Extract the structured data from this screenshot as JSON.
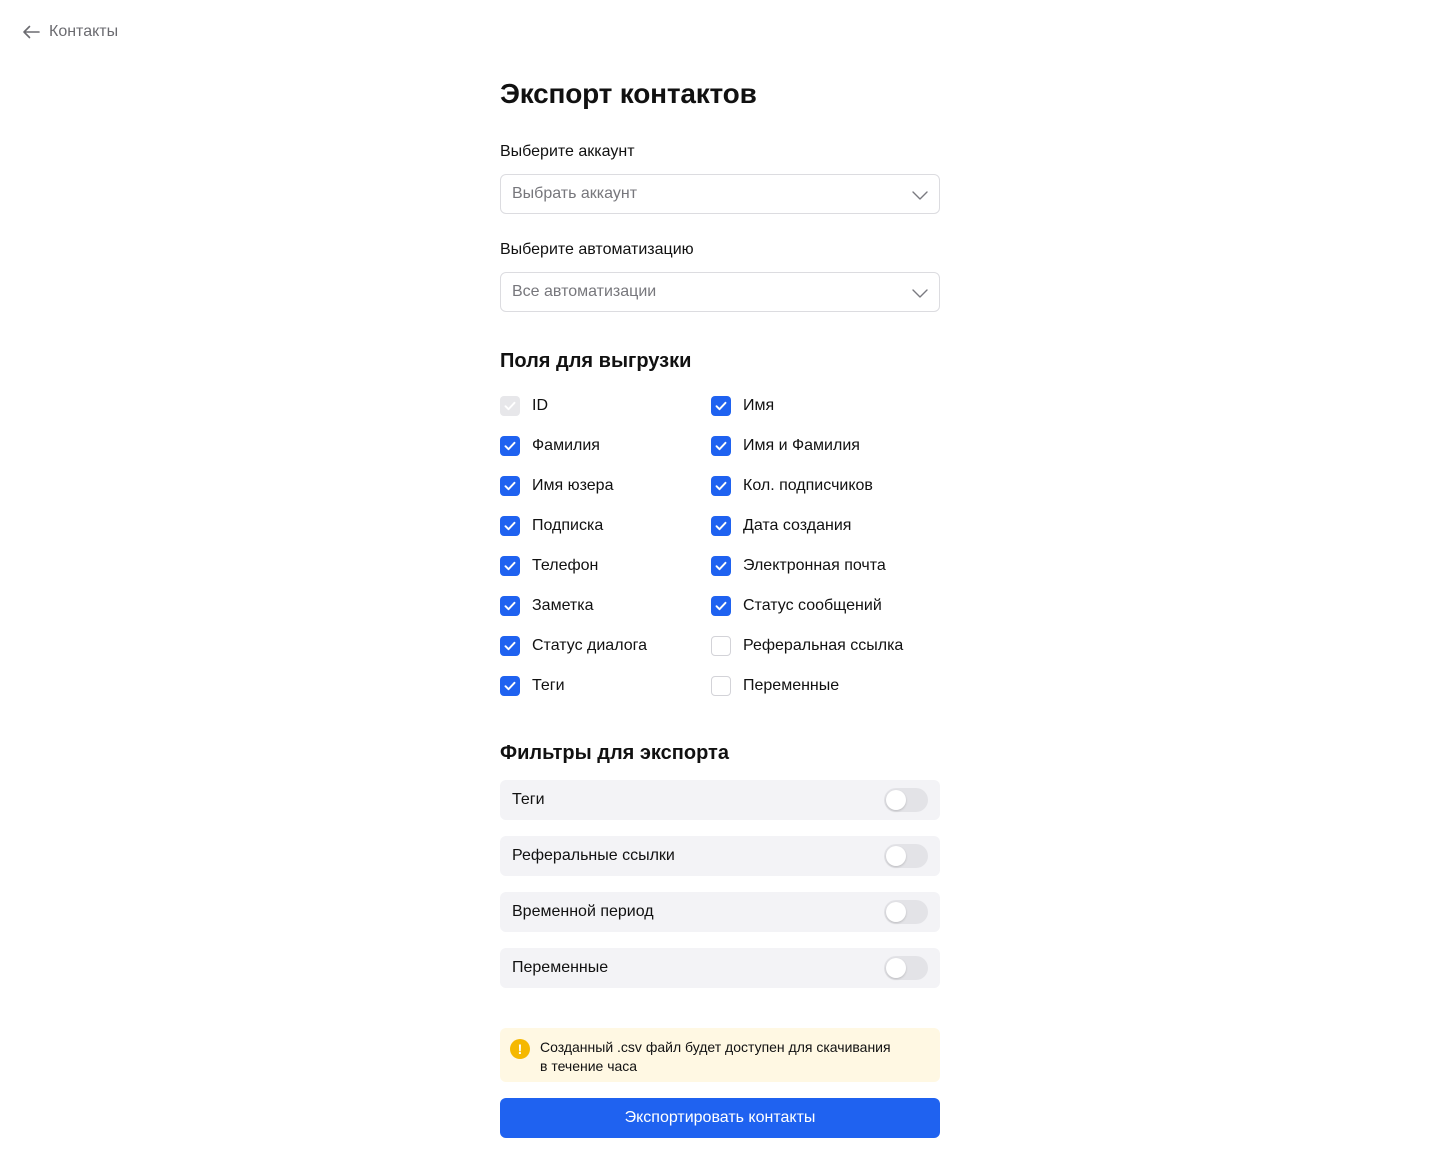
{
  "nav": {
    "back_label": "Контакты"
  },
  "title": "Экспорт контактов",
  "account": {
    "label": "Выберите аккаунт",
    "value": "Выбрать аккаунт"
  },
  "automation": {
    "label": "Выберите автоматизацию",
    "value": "Все автоматизации"
  },
  "fields": {
    "title": "Поля для выгрузки",
    "left": [
      {
        "label": "ID",
        "state": "disabled-checked"
      },
      {
        "label": "Фамилия",
        "state": "checked"
      },
      {
        "label": "Имя юзера",
        "state": "checked"
      },
      {
        "label": "Подписка",
        "state": "checked"
      },
      {
        "label": "Телефон",
        "state": "checked"
      },
      {
        "label": "Заметка",
        "state": "checked"
      },
      {
        "label": "Статус диалога",
        "state": "checked"
      },
      {
        "label": "Теги",
        "state": "checked"
      }
    ],
    "right": [
      {
        "label": "Имя",
        "state": "checked"
      },
      {
        "label": "Имя и Фамилия",
        "state": "checked"
      },
      {
        "label": "Кол. подписчиков",
        "state": "checked"
      },
      {
        "label": "Дата создания",
        "state": "checked"
      },
      {
        "label": "Электронная почта",
        "state": "checked"
      },
      {
        "label": "Статус сообщений",
        "state": "checked"
      },
      {
        "label": "Реферальная ссылка",
        "state": "unchecked"
      },
      {
        "label": "Переменные",
        "state": "unchecked"
      }
    ]
  },
  "filters": {
    "title": "Фильтры для экспорта",
    "items": [
      {
        "label": "Теги",
        "enabled": false
      },
      {
        "label": "Реферальные ссылки",
        "enabled": false
      },
      {
        "label": "Временной период",
        "enabled": false
      },
      {
        "label": "Переменные",
        "enabled": false
      }
    ]
  },
  "notice": {
    "text": "Созданный .csv файл будет доступен для скачивания\nв течение часа",
    "icon": "exclamation-icon"
  },
  "export_button": "Экспортировать контакты",
  "colors": {
    "accent": "#1f62f0",
    "notice_bg": "#fff8e3",
    "warning": "#f5b800",
    "filter_bg": "#f3f3f6"
  }
}
